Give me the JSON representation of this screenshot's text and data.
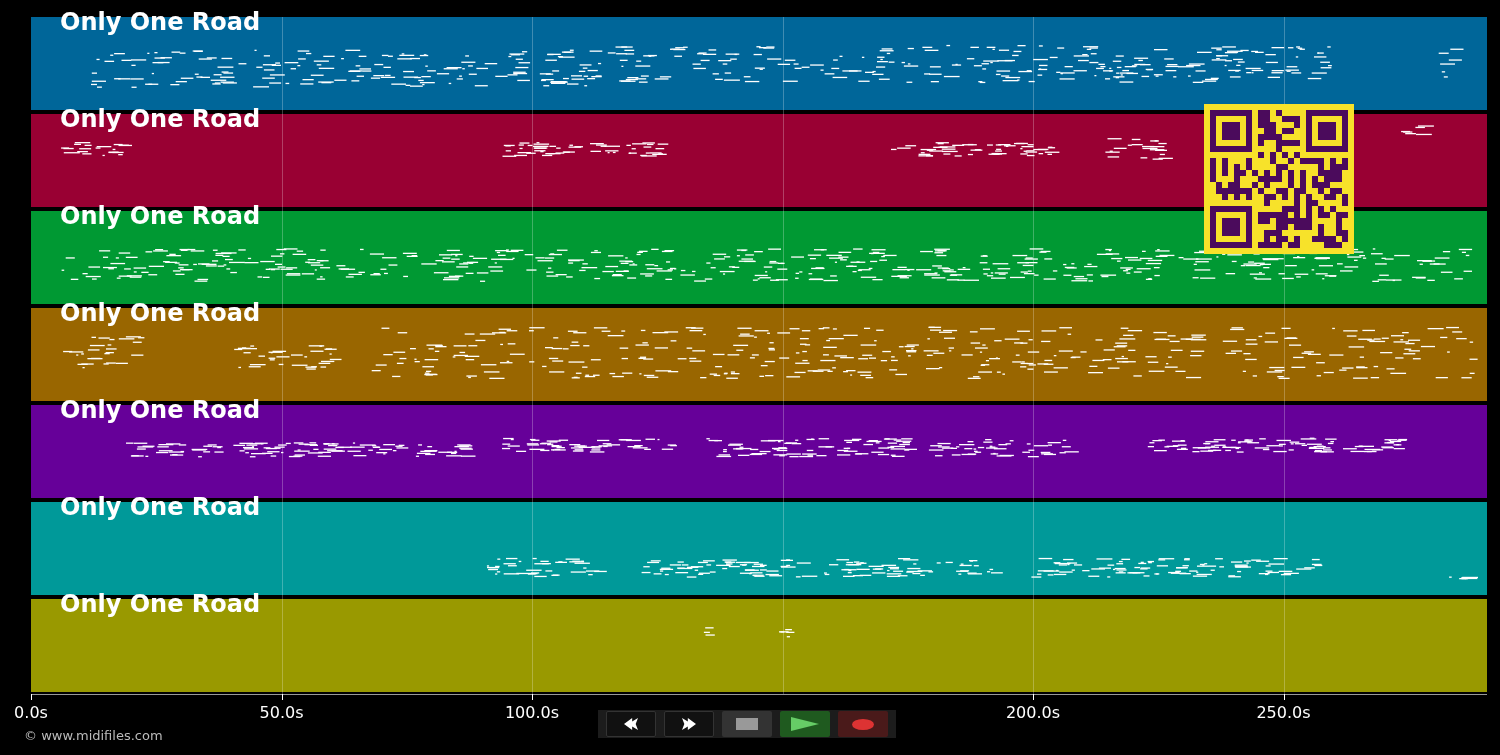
{
  "tracks": [
    {
      "title": "Only One Road",
      "color": "#006699"
    },
    {
      "title": "Only One Road",
      "color": "#990033"
    },
    {
      "title": "Only One Road",
      "color": "#009933"
    },
    {
      "title": "Only One Road",
      "color": "#996600"
    },
    {
      "title": "Only One Road",
      "color": "#660099"
    },
    {
      "title": "Only One Road",
      "color": "#009999"
    },
    {
      "title": "Only One Road",
      "color": "#999900"
    }
  ],
  "time_axis": {
    "ticks": [
      {
        "label": "0.0s"
      },
      {
        "label": "50.0s"
      },
      {
        "label": "100.0s"
      },
      {
        "label": "200.0s"
      },
      {
        "label": "250.0s"
      }
    ]
  },
  "transport": [
    {
      "kind": "rewind"
    },
    {
      "kind": "forward"
    },
    {
      "kind": "stop"
    },
    {
      "kind": "play"
    },
    {
      "kind": "record"
    }
  ],
  "copyright": "© www.midifiles.com"
}
